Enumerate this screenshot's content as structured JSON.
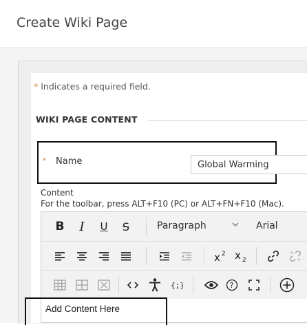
{
  "page": {
    "title": "Create Wiki Page"
  },
  "form": {
    "required_star": "*",
    "required_note": "Indicates a required field.",
    "section_heading": "WIKI PAGE CONTENT",
    "name": {
      "label": "Name",
      "value": "Global Warming"
    },
    "content": {
      "label": "Content",
      "toolbar_hint": "For the toolbar, press ALT+F10 (PC) or ALT+FN+F10 (Mac).",
      "editor_text": "Add Content Here"
    }
  },
  "toolbar": {
    "row1": {
      "bold": "B",
      "italic": "I",
      "underline": "U",
      "strike": "S",
      "format_value": "Paragraph",
      "font_value": "Arial"
    }
  },
  "icons": [
    "bold-icon",
    "italic-icon",
    "underline-icon",
    "strikethrough-icon",
    "chevron-down-icon",
    "align-left-icon",
    "align-center-icon",
    "align-right-icon",
    "align-justify-icon",
    "indent-icon",
    "outdent-icon",
    "superscript-icon",
    "subscript-icon",
    "link-icon",
    "unlink-icon",
    "insert-table-icon",
    "table-props-icon",
    "delete-table-icon",
    "source-code-icon",
    "accessibility-icon",
    "insert-variable-icon",
    "preview-icon",
    "help-icon",
    "fullscreen-icon",
    "add-content-icon"
  ],
  "colors": {
    "required": "#d68a48",
    "toolbar_bg": "#f2f2f2",
    "highlight_border": "#111111"
  }
}
